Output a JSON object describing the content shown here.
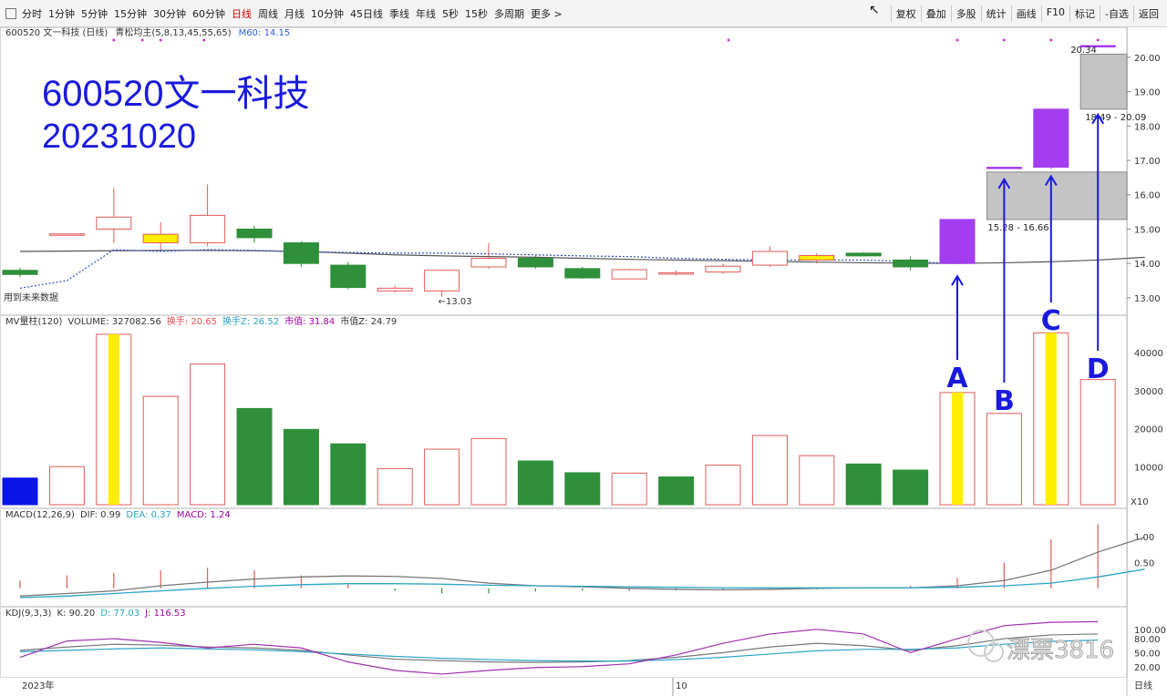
{
  "toolbar": {
    "tabs": [
      "分时",
      "1分钟",
      "5分钟",
      "15分钟",
      "30分钟",
      "60分钟",
      "日线",
      "周线",
      "月线",
      "10分钟",
      "45日线",
      "季线",
      "年线",
      "5秒",
      "15秒",
      "多周期",
      "更多 >"
    ],
    "active_tab": "日线",
    "right_buttons": [
      "复权",
      "叠加",
      "多股",
      "统计",
      "画线",
      "F10",
      "标记",
      "-自选",
      "返回"
    ]
  },
  "overlay": {
    "title_line1": "600520文一科技",
    "title_line2": "20231020",
    "watermark": "漂票3816"
  },
  "chart_data": [
    {
      "type": "candlestick",
      "title": "600520 文一科技 (日线)",
      "indicator_label": "青松均主(5,8,13,45,55,65)",
      "ma_label": "M60: 14.15",
      "ylim": [
        12.6,
        20.5
      ],
      "y_ticks": [
        13,
        14,
        15,
        16,
        17,
        18,
        19,
        20
      ],
      "candles": [
        {
          "o": 13.8,
          "h": 13.88,
          "l": 13.6,
          "c": 13.68
        },
        {
          "o": 14.86,
          "h": 14.86,
          "l": 14.86,
          "c": 14.86
        },
        {
          "o": 15.0,
          "h": 16.2,
          "l": 14.6,
          "c": 15.35
        },
        {
          "o": 14.85,
          "h": 15.2,
          "l": 14.4,
          "c": 14.6
        },
        {
          "o": 14.6,
          "h": 16.3,
          "l": 14.5,
          "c": 15.4
        },
        {
          "o": 15.0,
          "h": 15.1,
          "l": 14.6,
          "c": 14.75
        },
        {
          "o": 14.6,
          "h": 14.65,
          "l": 13.9,
          "c": 14.0
        },
        {
          "o": 13.95,
          "h": 14.05,
          "l": 13.25,
          "c": 13.3
        },
        {
          "o": 13.2,
          "h": 13.35,
          "l": 13.15,
          "c": 13.28
        },
        {
          "o": 13.2,
          "h": 13.82,
          "l": 13.03,
          "c": 13.8
        },
        {
          "o": 13.9,
          "h": 14.6,
          "l": 13.85,
          "c": 14.15
        },
        {
          "o": 14.15,
          "h": 14.25,
          "l": 13.85,
          "c": 13.9
        },
        {
          "o": 13.85,
          "h": 13.9,
          "l": 13.55,
          "c": 13.58
        },
        {
          "o": 13.55,
          "h": 13.85,
          "l": 13.55,
          "c": 13.82
        },
        {
          "o": 13.72,
          "h": 13.8,
          "l": 13.65,
          "c": 13.73
        },
        {
          "o": 13.75,
          "h": 14.0,
          "l": 13.7,
          "c": 13.92
        },
        {
          "o": 13.95,
          "h": 14.5,
          "l": 13.9,
          "c": 14.35
        },
        {
          "o": 14.1,
          "h": 14.3,
          "l": 14.0,
          "c": 14.23
        },
        {
          "o": 14.3,
          "h": 14.33,
          "l": 14.2,
          "c": 14.22
        },
        {
          "o": 14.1,
          "h": 14.2,
          "l": 13.8,
          "c": 13.9
        },
        {
          "o": 14.0,
          "h": 15.28,
          "l": 14.0,
          "c": 15.28
        },
        {
          "o": 16.8,
          "h": 16.8,
          "l": 16.78,
          "c": 16.8
        },
        {
          "o": 16.8,
          "h": 18.49,
          "l": 16.75,
          "c": 18.49
        },
        {
          "o": 20.34,
          "h": 20.34,
          "l": 20.34,
          "c": 20.34
        }
      ],
      "ma_dashed": [
        13.28,
        13.5,
        14.4,
        14.35,
        14.4,
        14.38,
        14.34,
        14.32,
        14.3,
        14.3,
        14.28,
        14.25,
        14.22,
        14.2,
        14.15,
        14.12,
        14.1,
        14.1,
        14.1,
        14.05,
        14.0
      ],
      "ma_solid": [
        14.35,
        14.36,
        14.37,
        14.38,
        14.38,
        14.37,
        14.35,
        14.3,
        14.25,
        14.22,
        14.2,
        14.18,
        14.15,
        14.12,
        14.1,
        14.08,
        14.06,
        14.04,
        14.02,
        14.01,
        14.0,
        14.02,
        14.05,
        14.1,
        14.18
      ],
      "annotations": {
        "low_label": "←13.03",
        "future_label": "用到未来数据",
        "gap1_label": "15.28 - 16.66",
        "gap2_label": "18.49 - 20.09",
        "high_label": "20.34"
      },
      "zones": [
        {
          "from_candle": 21,
          "y0": 15.28,
          "y1": 16.66
        },
        {
          "from_candle": 23,
          "y0": 18.49,
          "y1": 20.09
        }
      ],
      "markers": [
        {
          "label": "A",
          "candle": 20
        },
        {
          "label": "B",
          "candle": 21
        },
        {
          "label": "C",
          "candle": 22
        },
        {
          "label": "D",
          "candle": 23
        }
      ],
      "x_labels": [
        "2023年",
        "10"
      ]
    },
    {
      "type": "bar",
      "title": "MV量柱(120)",
      "header": [
        {
          "text": "MV量柱(120)",
          "color": "#333333"
        },
        {
          "text": "VOLUME: 327082.56",
          "color": "#333333"
        },
        {
          "text": "换手: 20.65",
          "color": "#e05050"
        },
        {
          "text": "换手Z: 26.52",
          "color": "#2aa3c8"
        },
        {
          "text": "市值: 31.84",
          "color": "#a000a0"
        },
        {
          "text": "市值Z: 24.79",
          "color": "#333333"
        }
      ],
      "ylim": [
        0,
        46000
      ],
      "y_ticks": [
        10000,
        20000,
        30000,
        40000
      ],
      "unit": "X10",
      "values": [
        7000,
        10000,
        44800,
        28500,
        37000,
        25300,
        19800,
        16000,
        9500,
        14600,
        17400,
        11500,
        8400,
        8300,
        7300,
        10400,
        18200,
        12900,
        10700,
        9100,
        29500,
        24000,
        45200,
        32900
      ],
      "styles": [
        "blue",
        "hollow",
        "hollow-yellow",
        "hollow",
        "hollow",
        "green",
        "green",
        "green",
        "hollow",
        "hollow",
        "hollow",
        "green",
        "green",
        "hollow",
        "green",
        "hollow",
        "hollow",
        "hollow",
        "green",
        "green",
        "hollow-yellow",
        "hollow",
        "hollow-yellow",
        "hollow"
      ]
    },
    {
      "type": "line",
      "title": "MACD(12,26,9)",
      "header": [
        {
          "text": "MACD(12,26,9)",
          "color": "#333333"
        },
        {
          "text": "DIF: 0.99",
          "color": "#333333"
        },
        {
          "text": "DEA: 0.37",
          "color": "#2aa3c8"
        },
        {
          "text": "MACD: 1.24",
          "color": "#a000a0"
        }
      ],
      "ylim": [
        -0.25,
        1.3
      ],
      "y_ticks": [
        0.5,
        1.0
      ],
      "dif": [
        -0.15,
        -0.1,
        -0.05,
        0.05,
        0.12,
        0.18,
        0.22,
        0.24,
        0.23,
        0.19,
        0.1,
        0.05,
        0.03,
        0.0,
        -0.02,
        -0.03,
        -0.02,
        0.0,
        0.01,
        0.01,
        0.05,
        0.15,
        0.35,
        0.7,
        0.99
      ],
      "dea": [
        -0.18,
        -0.15,
        -0.1,
        -0.05,
        0.0,
        0.04,
        0.07,
        0.09,
        0.09,
        0.08,
        0.06,
        0.05,
        0.04,
        0.03,
        0.02,
        0.01,
        0.01,
        0.01,
        0.01,
        0.01,
        0.02,
        0.05,
        0.1,
        0.22,
        0.37
      ],
      "macd": [
        0.15,
        0.25,
        0.3,
        0.35,
        0.4,
        0.35,
        0.25,
        0.1,
        -0.05,
        -0.1,
        -0.1,
        -0.06,
        -0.05,
        -0.05,
        -0.04,
        -0.03,
        -0.02,
        -0.02,
        0.0,
        0.05,
        0.2,
        0.5,
        0.95,
        1.24
      ]
    },
    {
      "type": "line",
      "title": "KDJ(9,3,3)",
      "header": [
        {
          "text": "KDJ(9,3,3)",
          "color": "#333333"
        },
        {
          "text": "K: 90.20",
          "color": "#333333"
        },
        {
          "text": "D: 77.03",
          "color": "#2aa3c8"
        },
        {
          "text": "J: 116.53",
          "color": "#a000a0"
        }
      ],
      "ylim": [
        0,
        125
      ],
      "y_ticks": [
        20,
        50,
        80,
        100
      ],
      "k": [
        55,
        62,
        68,
        66,
        62,
        60,
        55,
        45,
        36,
        33,
        30,
        29,
        30,
        33,
        40,
        50,
        62,
        70,
        65,
        55,
        65,
        80,
        88,
        90
      ],
      "d": [
        52,
        55,
        58,
        60,
        58,
        56,
        52,
        47,
        42,
        38,
        35,
        33,
        32,
        32,
        35,
        40,
        47,
        54,
        57,
        57,
        60,
        68,
        74,
        77
      ],
      "j": [
        40,
        75,
        80,
        72,
        60,
        68,
        60,
        30,
        12,
        4,
        12,
        18,
        20,
        26,
        45,
        70,
        90,
        100,
        90,
        50,
        80,
        108,
        115,
        116.5
      ]
    }
  ]
}
